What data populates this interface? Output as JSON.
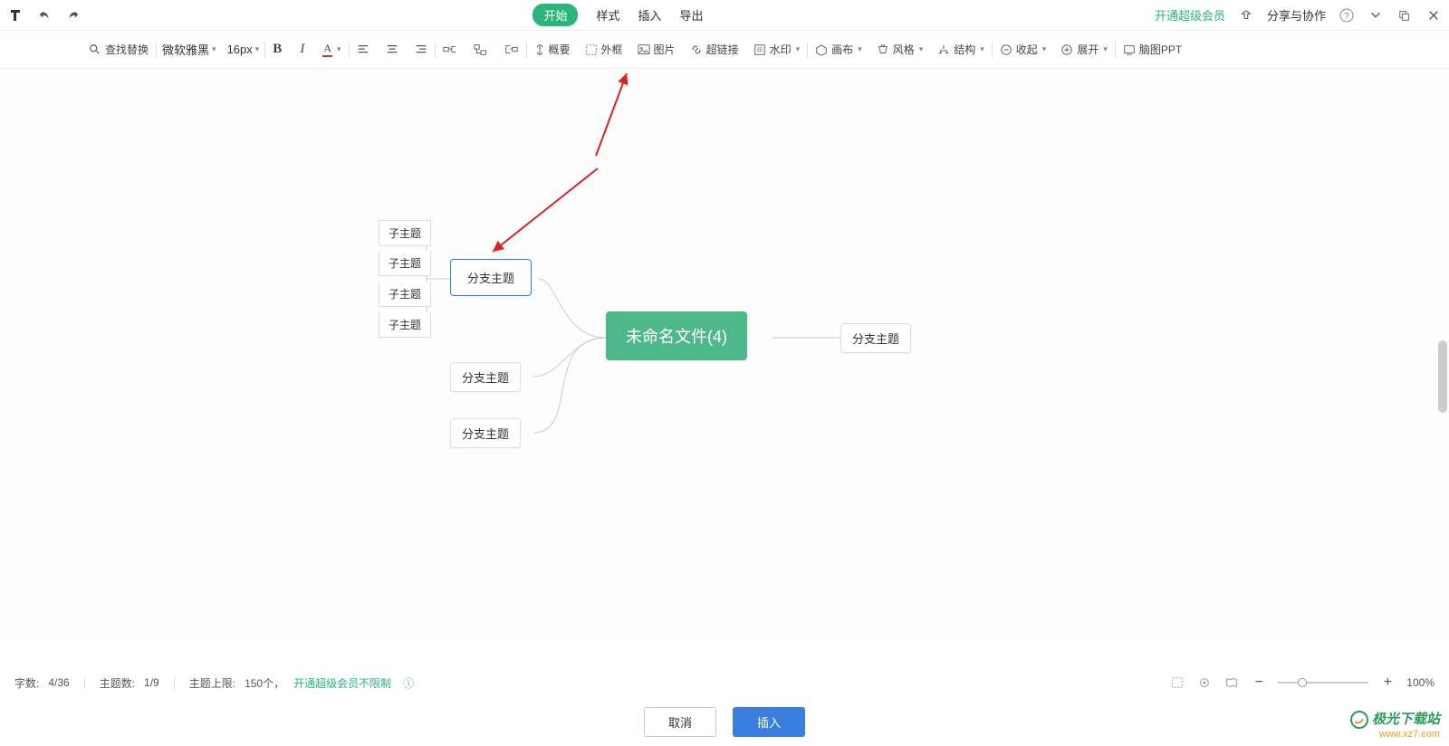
{
  "topbar": {
    "tabs": {
      "start": "开始",
      "style": "样式",
      "insert": "插入",
      "export": "导出"
    },
    "member": "开通超级会员",
    "share": "分享与协作"
  },
  "toolbar": {
    "search": "查找替换",
    "font": "微软雅黑",
    "fontsize": "16px",
    "summary": "概要",
    "frame": "外框",
    "image": "图片",
    "hyperlink": "超链接",
    "watermark": "水印",
    "canvas": "画布",
    "style": "风格",
    "structure": "结构",
    "collapse": "收起",
    "expand": "展开",
    "mindppt": "脑图PPT"
  },
  "mindmap": {
    "root": "未命名文件(4)",
    "branch_selected": "分支主题",
    "branch2": "分支主题",
    "branch3": "分支主题",
    "branch_right": "分支主题",
    "sub1": "子主题",
    "sub2": "子主题",
    "sub3": "子主题",
    "sub4": "子主题"
  },
  "status": {
    "wordcount_label": "字数:",
    "wordcount": "4/36",
    "topiccount_label": "主题数:",
    "topiccount": "1/9",
    "topiclimit_label": "主题上限:",
    "topiclimit": "150个，",
    "upgrade": "开通超级会员不限制",
    "zoom": "100%"
  },
  "buttons": {
    "cancel": "取消",
    "insert": "插入"
  },
  "watermark_logo": {
    "line1": "极光下载站",
    "line2": "www.xz7.com"
  }
}
